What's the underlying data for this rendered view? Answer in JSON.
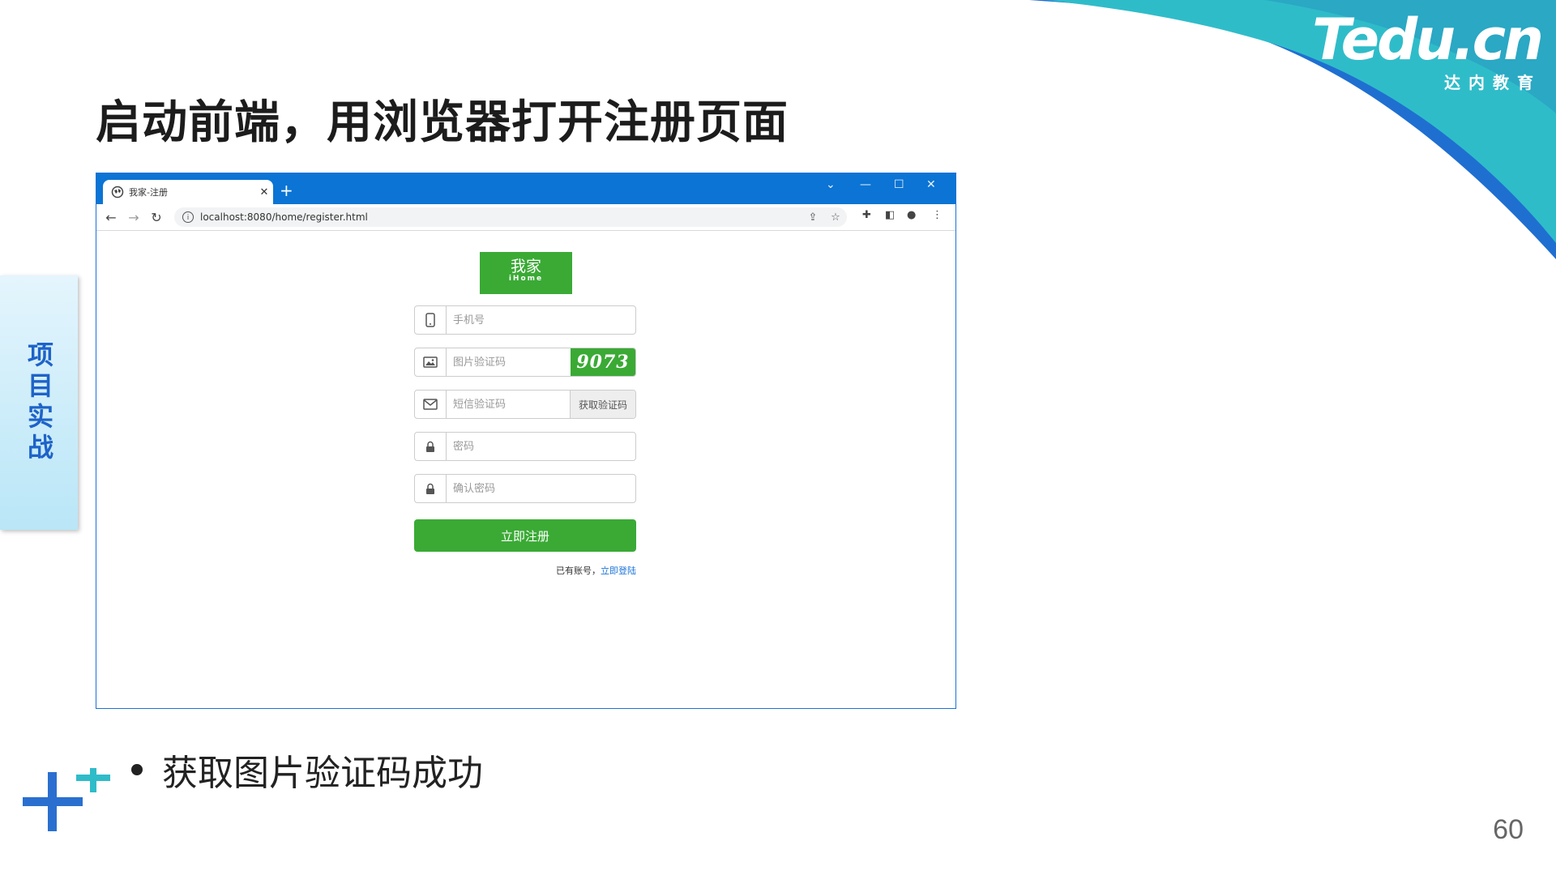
{
  "slide": {
    "title": "启动前端，用浏览器打开注册页面",
    "side_tab": "项目实战",
    "bullet": "获取图片验证码成功",
    "page_number": "60",
    "brand_logo": "Tedu.cn",
    "brand_subtitle": "达内教育"
  },
  "browser": {
    "tab_title": "我家-注册",
    "new_tab": "+",
    "url": "localhost:8080/home/register.html",
    "window_controls": [
      "⌄",
      "—",
      "☐",
      "✕"
    ]
  },
  "page": {
    "logo_cn": "我家",
    "logo_en": "iHome",
    "fields": {
      "mobile_placeholder": "手机号",
      "image_code_placeholder": "图片验证码",
      "sms_code_placeholder": "短信验证码",
      "password_placeholder": "密码",
      "password2_placeholder": "确认密码"
    },
    "captcha_text": "9073",
    "sms_button": "获取验证码",
    "submit_button": "立即注册",
    "have_account": "已有账号，",
    "login_link": "立即登陆"
  },
  "colors": {
    "accent_green": "#3aaa35",
    "browser_blue": "#0b74d4",
    "link_blue": "#1a73d8",
    "title_blue": "#1e63c8",
    "teal": "#2fbcc9"
  }
}
